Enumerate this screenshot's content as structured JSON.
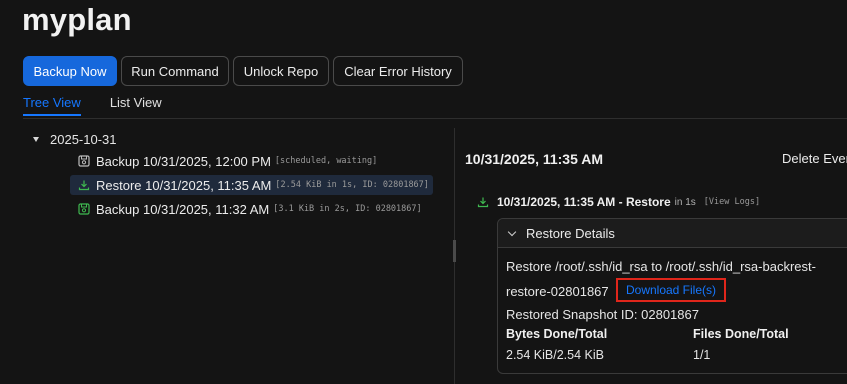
{
  "plan": {
    "title": "myplan"
  },
  "toolbar": {
    "backup_now": "Backup Now",
    "run_command": "Run Command",
    "unlock_repo": "Unlock Repo",
    "clear_error_history": "Clear Error History"
  },
  "tabs": [
    {
      "label": "Tree View",
      "active": true
    },
    {
      "label": "List View",
      "active": false
    }
  ],
  "tree": {
    "group_label": "2025-10-31",
    "items": [
      {
        "label": "Backup 10/31/2025, 12:00 PM",
        "meta": "[scheduled, waiting]",
        "icon": "backup-pending-icon",
        "selected": false
      },
      {
        "label": "Restore 10/31/2025, 11:35 AM",
        "meta": "[2.54 KiB in 1s, ID: 02801867]",
        "icon": "download-icon",
        "selected": true
      },
      {
        "label": "Backup 10/31/2025, 11:32 AM",
        "meta": "[3.1 KiB in 2s, ID: 02801867]",
        "icon": "backup-success-icon",
        "selected": false
      }
    ]
  },
  "detail": {
    "title": "10/31/2025, 11:35 AM",
    "delete_event": "Delete Event",
    "operation": {
      "title": "10/31/2025, 11:35 AM - Restore",
      "duration": "in 1s",
      "view_logs": "[View Logs]"
    },
    "panel": {
      "title": "Restore Details",
      "restore_text_line1": "Restore /root/.ssh/id_rsa to /root/.ssh/id_rsa-backrest-",
      "restore_text_line2": "restore-02801867",
      "download_label": "Download File(s)",
      "snapshot": "Restored Snapshot ID: 02801867",
      "bytes_header": "Bytes Done/Total",
      "bytes_value": "2.54 KiB/2.54 KiB",
      "files_header": "Files Done/Total",
      "files_value": "1/1"
    }
  },
  "colors": {
    "accent": "#1677ff",
    "primary_button": "#1668dc",
    "success": "#3fb950",
    "highlight_box": "#e0261b"
  }
}
